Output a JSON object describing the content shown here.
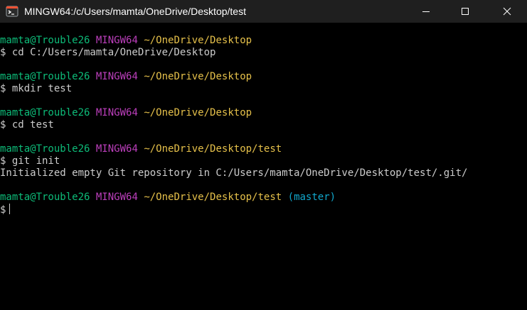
{
  "window": {
    "title": "MINGW64:/c/Users/mamta/OneDrive/Desktop/test",
    "icon": "git-bash-icon",
    "buttons": [
      "minimize-icon",
      "maximize-icon",
      "close-icon"
    ]
  },
  "terminal": {
    "colors": {
      "background": "#000000",
      "user": "#0dbc79",
      "system": "#bc3fbc",
      "path": "#e5c04a",
      "branch": "#11a8cd",
      "text": "#cccccc"
    },
    "blocks": [
      {
        "user": "mamta@Trouble26",
        "system": "MINGW64",
        "path": "~/OneDrive/Desktop",
        "command": "$ cd C:/Users/mamta/OneDrive/Desktop"
      },
      {
        "user": "mamta@Trouble26",
        "system": "MINGW64",
        "path": "~/OneDrive/Desktop",
        "command": "$ mkdir test"
      },
      {
        "user": "mamta@Trouble26",
        "system": "MINGW64",
        "path": "~/OneDrive/Desktop",
        "command": "$ cd test"
      },
      {
        "user": "mamta@Trouble26",
        "system": "MINGW64",
        "path": "~/OneDrive/Desktop/test",
        "command": "$ git init",
        "output": "Initialized empty Git repository in C:/Users/mamta/OneDrive/Desktop/test/.git/"
      },
      {
        "user": "mamta@Trouble26",
        "system": "MINGW64",
        "path": "~/OneDrive/Desktop/test",
        "branch": "(master)",
        "command": "$"
      }
    ]
  }
}
